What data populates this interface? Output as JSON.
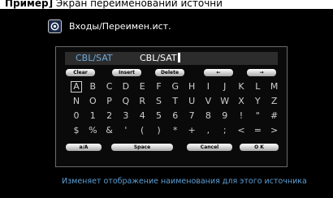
{
  "caption": {
    "bold": "Пример]",
    "text": " Экран переименований источни"
  },
  "header": {
    "title": "Входы/Переимен.ист.",
    "icon": "input-icon"
  },
  "name_field": {
    "source": "CBL/SAT",
    "value": "CBL/SAT"
  },
  "top_buttons": [
    {
      "label": "Clear",
      "name": "clear-button"
    },
    {
      "label": "Insert",
      "name": "insert-button"
    },
    {
      "label": "Delete",
      "name": "delete-button"
    },
    {
      "label": "←",
      "name": "cursor-left-button"
    },
    {
      "label": "→",
      "name": "cursor-right-button"
    }
  ],
  "keyboard": [
    [
      "A",
      "B",
      "C",
      "D",
      "E",
      "F",
      "G",
      "H",
      "I",
      "J",
      "K",
      "L",
      "M"
    ],
    [
      "N",
      "O",
      "P",
      "Q",
      "R",
      "S",
      "T",
      "U",
      "V",
      "W",
      "X",
      "Y",
      "Z"
    ],
    [
      "0",
      "1",
      "2",
      "3",
      "4",
      "5",
      "6",
      "7",
      "8",
      "9",
      "!",
      "\"",
      "#"
    ],
    [
      "$",
      "%",
      "&",
      "'",
      "(",
      ")",
      "*",
      "+",
      ",",
      ";",
      "<",
      "=",
      ">"
    ]
  ],
  "selected_key": "A",
  "bottom_buttons": [
    {
      "label": "a/A",
      "name": "case-toggle-button"
    },
    {
      "label": "Space",
      "name": "space-button"
    },
    {
      "label": "Cancel",
      "name": "cancel-button"
    },
    {
      "label": "O K",
      "name": "ok-button"
    }
  ],
  "help_text": "Изменяет отображение наименования для этого источника",
  "colors": {
    "accent": "#5d9fd4",
    "background": "#000000",
    "key_text": "#cfcfcf"
  }
}
